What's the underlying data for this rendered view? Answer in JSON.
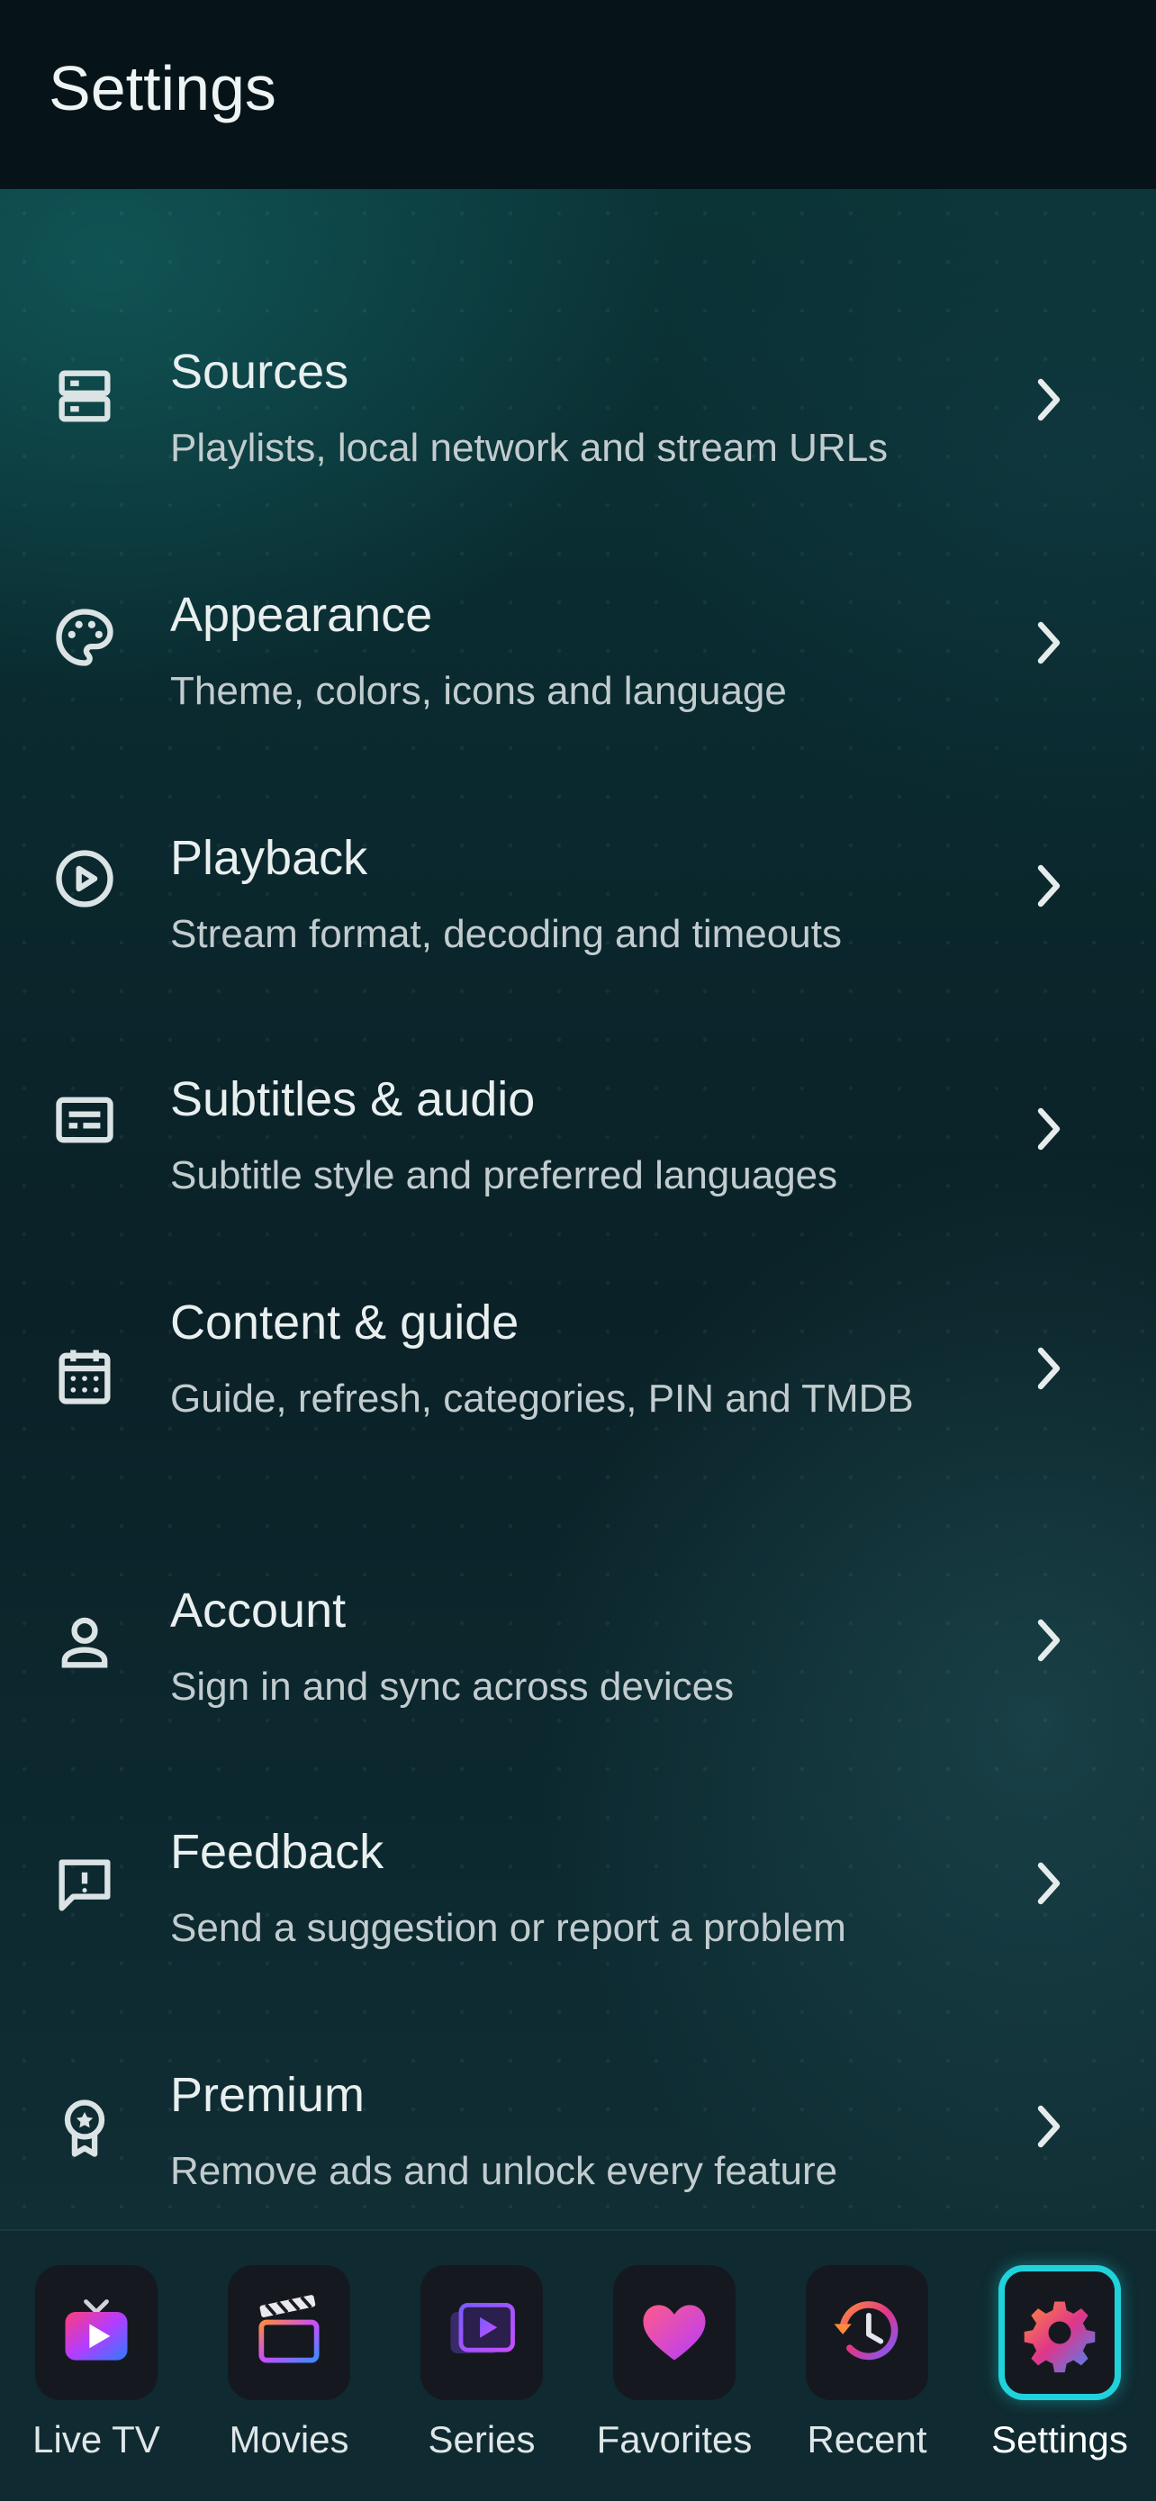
{
  "header": {
    "title": "Settings"
  },
  "settings": {
    "items": [
      {
        "title": "Sources",
        "subtitle": "Playlists, local network and stream URLs",
        "icon": "storage-icon"
      },
      {
        "title": "Appearance",
        "subtitle": "Theme, colors, icons and language",
        "icon": "palette-icon"
      },
      {
        "title": "Playback",
        "subtitle": "Stream format, decoding and timeouts",
        "icon": "play-circle-icon"
      },
      {
        "title": "Subtitles & audio",
        "subtitle": "Subtitle style and preferred languages",
        "icon": "subtitles-icon"
      },
      {
        "title": "Content & guide",
        "subtitle": "Guide, refresh, categories, PIN and TMDB",
        "icon": "calendar-icon"
      },
      {
        "title": "Account",
        "subtitle": "Sign in and sync across devices",
        "icon": "person-icon"
      },
      {
        "title": "Feedback",
        "subtitle": "Send a suggestion or report a problem",
        "icon": "feedback-icon"
      },
      {
        "title": "Premium",
        "subtitle": "Remove ads and unlock every feature",
        "icon": "award-icon"
      }
    ]
  },
  "nav": {
    "items": [
      {
        "label": "Live TV",
        "icon": "live-tv-icon",
        "active": false
      },
      {
        "label": "Movies",
        "icon": "clapperboard-icon",
        "active": false
      },
      {
        "label": "Series",
        "icon": "series-icon",
        "active": false
      },
      {
        "label": "Favorites",
        "icon": "heart-icon",
        "active": false
      },
      {
        "label": "Recent",
        "icon": "history-icon",
        "active": false
      },
      {
        "label": "Settings",
        "icon": "gear-icon",
        "active": true
      }
    ]
  },
  "colors": {
    "accent": "#1fd2dc",
    "background": "#0a2a2f",
    "nav_background": "#0f2a30"
  }
}
